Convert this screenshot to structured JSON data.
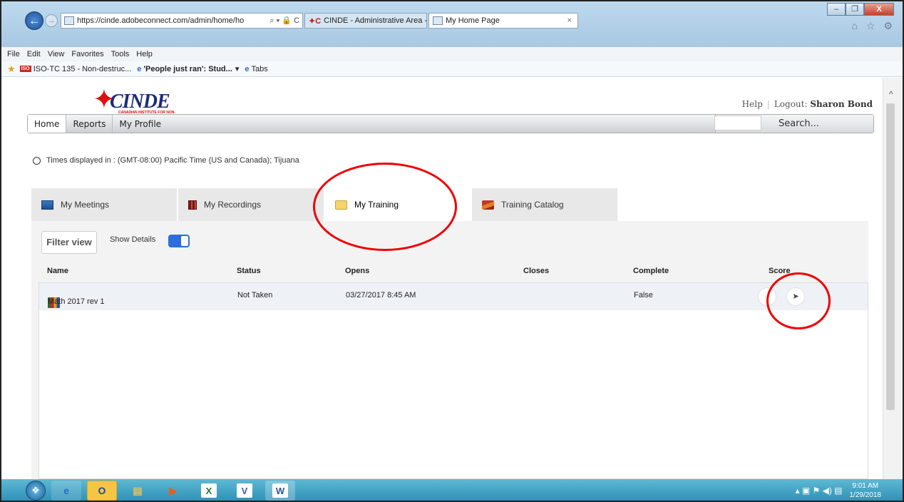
{
  "browser": {
    "url": "https://cinde.adobeconnect.com/admin/home/ho",
    "address_controls": "⌕ ▾ 🔒 C",
    "tabs": [
      {
        "label": "CINDE - Administrative Area - ..."
      },
      {
        "label": "My Home Page",
        "close": "×"
      }
    ],
    "menu": [
      "File",
      "Edit",
      "View",
      "Favorites",
      "Tools",
      "Help"
    ],
    "favorites": [
      {
        "label": "ISO-TC 135 - Non-destruc..."
      },
      {
        "label": "'People just ran': Stud..."
      },
      {
        "label": "Tabs"
      }
    ],
    "window_controls": {
      "minimize": "–",
      "restore": "❐",
      "close": "X"
    },
    "chrome_icons": "⌂ ☆ ⚙"
  },
  "site": {
    "logo_text": "CINDE",
    "logo_sub": "CANADIAN INSTITUTE FOR NON-DESTRUCTIVE EVALUATION",
    "help": "Help",
    "logout": "Logout:",
    "user": "Sharon Bond",
    "nav": [
      "Home",
      "Reports",
      "My Profile"
    ],
    "search": "Search..."
  },
  "timezone": "Times displayed in : (GMT-08:00) Pacific Time (US and Canada); Tijuana",
  "page_tabs": [
    {
      "label": "My Meetings",
      "icon": "meeting-icon"
    },
    {
      "label": "My Recordings",
      "icon": "recording-icon"
    },
    {
      "label": "My Training",
      "icon": "folder-icon"
    },
    {
      "label": "Training Catalog",
      "icon": "books-icon"
    }
  ],
  "panel": {
    "filter_label": "Filter view",
    "show_details_label": "Show Details",
    "show_details_on": true,
    "columns": [
      "Name",
      "Status",
      "Opens",
      "Closes",
      "Complete",
      "Score"
    ],
    "rows": [
      {
        "name": "Math 2017 rev 1",
        "status": "Not Taken",
        "opens": "03/27/2017 8:45 AM",
        "closes": "",
        "complete": "False",
        "score_action": "➤"
      }
    ]
  },
  "taskbar": {
    "time": "9:01 AM",
    "date": "1/29/2018"
  },
  "annotation_color": "#e00000"
}
